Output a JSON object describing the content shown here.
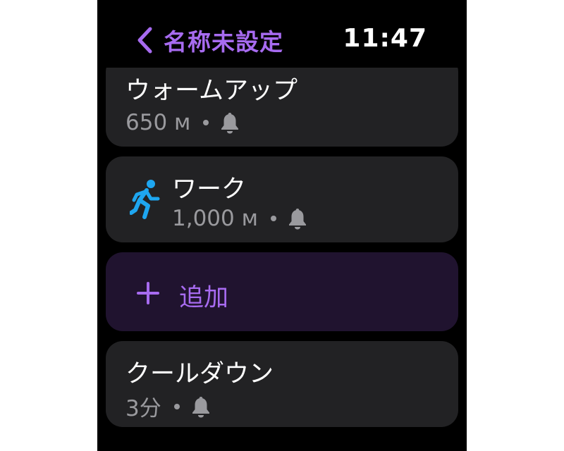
{
  "header": {
    "back_label": "名称未設定",
    "time": "11:47"
  },
  "steps": [
    {
      "title": "ウォームアップ",
      "value": "650 ᴍ",
      "icon": "bell-icon"
    },
    {
      "title": "ワーク",
      "value": "1,000 ᴍ",
      "icon": "running-figure-icon"
    },
    {
      "title": "クールダウン",
      "value": "3分",
      "icon": "bell-icon"
    }
  ],
  "add_button": {
    "label": "追加"
  },
  "colors": {
    "accent": "#a76bf0",
    "runner": "#1ea6f0",
    "card": "#222224",
    "add_card": "#20132f",
    "secondary_text": "#9a9a9e"
  }
}
